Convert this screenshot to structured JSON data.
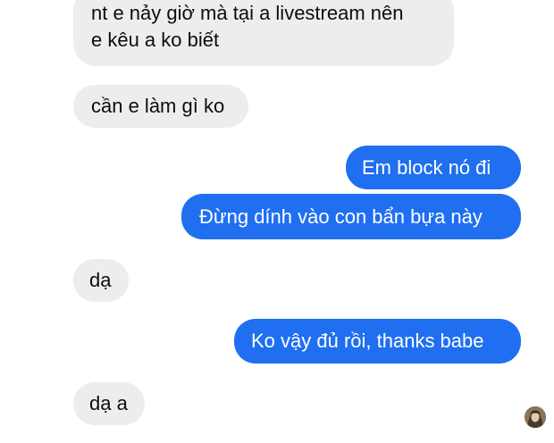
{
  "conversation": {
    "messages": [
      {
        "id": "m1",
        "direction": "incoming",
        "lines": [
          "nt e nảy giờ mà tại a livestream nên",
          "e kêu a ko biết"
        ]
      },
      {
        "id": "m2",
        "direction": "incoming",
        "text": "cần e làm gì ko"
      },
      {
        "id": "m3",
        "direction": "outgoing",
        "text": "Em block nó đi"
      },
      {
        "id": "m4",
        "direction": "outgoing",
        "text": "Đừng dính vào con bẩn bựa này"
      },
      {
        "id": "m5",
        "direction": "incoming",
        "text": "dạ"
      },
      {
        "id": "m6",
        "direction": "outgoing",
        "text": "Ko vậy đủ rồi, thanks babe"
      },
      {
        "id": "m7",
        "direction": "incoming",
        "text": "dạ a"
      }
    ],
    "read_receipt_icon": "seen-avatar-icon"
  },
  "colors": {
    "incoming_bubble": "#ededed",
    "outgoing_bubble": "#1f6ff0",
    "incoming_text": "#0d0d0d",
    "outgoing_text": "#ffffff"
  }
}
